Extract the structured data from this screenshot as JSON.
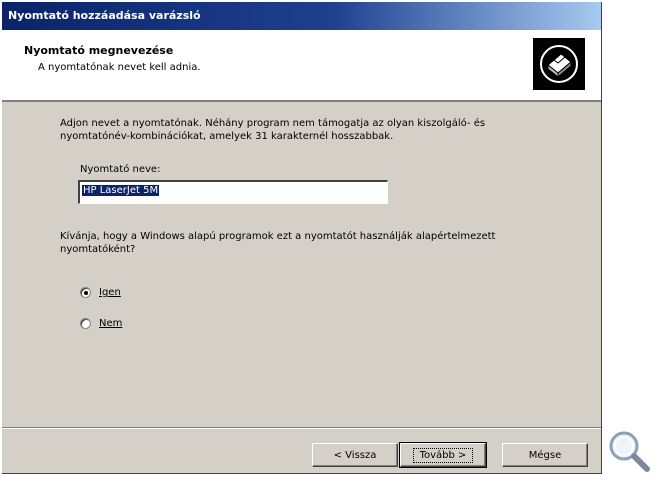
{
  "window": {
    "title": "Nyomtató hozzáadása varázsló"
  },
  "header": {
    "title": "Nyomtató megnevezése",
    "subtitle": "A nyomtatónak nevet kell adnia.",
    "icon": "printer-icon"
  },
  "body": {
    "intro_line1": "Adjon nevet a nyomtatónak. Néhány program nem támogatja az olyan kiszolgáló- és",
    "intro_line2": "nyomtatónév-kombinációkat, amelyek 31 karakternél hosszabbak.",
    "name_label": "Nyomtató neve:",
    "name_value": "HP LaserJet 5M",
    "question_line1": "Kívánja, hogy a Windows alapú programok ezt a nyomtatót használják alapértelmezett",
    "question_line2": "nyomtatóként?",
    "options": [
      {
        "label": "Igen",
        "checked": true
      },
      {
        "label": "Nem",
        "checked": false
      }
    ]
  },
  "buttons": {
    "back": "< Vissza",
    "next": "Tovább >",
    "cancel": "Mégse"
  },
  "decor": {
    "zoom_icon": "magnifier-icon"
  },
  "colors": {
    "titlebar": "#0a246a",
    "face": "#d4d0c8",
    "selection": "#0a246a"
  }
}
